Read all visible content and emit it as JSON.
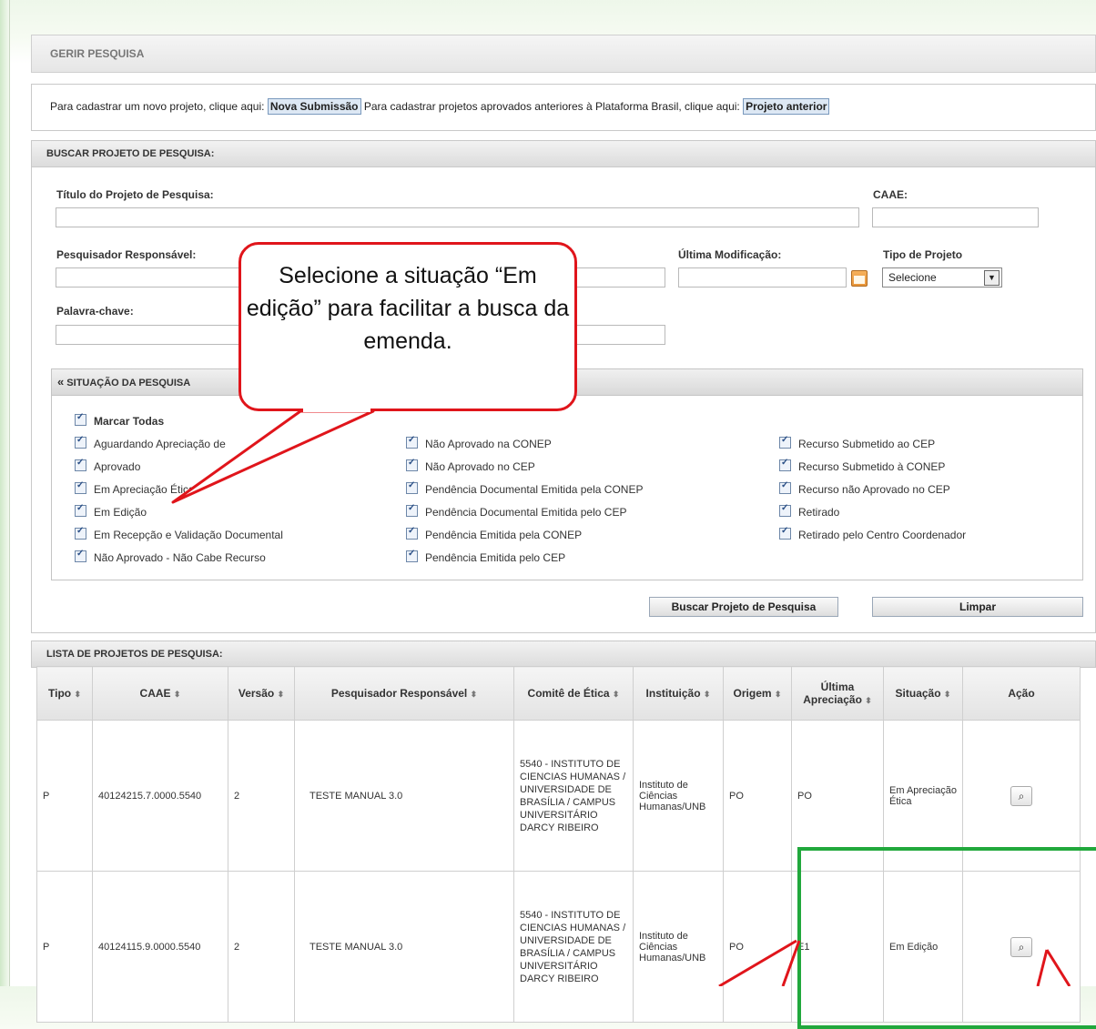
{
  "header": {
    "title": "GERIR PESQUISA"
  },
  "intro": {
    "text1": "Para cadastrar um novo projeto, clique aqui:",
    "btn_nova": "Nova Submissão",
    "text2": "Para cadastrar projetos aprovados anteriores à Plataforma Brasil, clique aqui:",
    "btn_anterior": "Projeto anterior"
  },
  "search": {
    "header": "BUSCAR PROJETO DE PESQUISA:",
    "label_titulo": "Título do Projeto de Pesquisa:",
    "label_caae": "CAAE:",
    "label_pesquisador": "Pesquisador Responsável:",
    "label_ultima": "Última Modificação:",
    "label_tipo": "Tipo de Projeto",
    "tipo_value": "Selecione",
    "label_palavra": "Palavra-chave:"
  },
  "situacao": {
    "header": "SITUAÇÃO DA PESQUISA",
    "collapse_icon": "«",
    "marcar_todas": "Marcar Todas",
    "col1": [
      "Aguardando Apreciação de",
      "Aprovado",
      "Em Apreciação Ética",
      "Em Edição",
      "Em Recepção e Validação Documental",
      "Não Aprovado - Não Cabe Recurso"
    ],
    "col2": [
      "Não Aprovado na CONEP",
      "Não Aprovado no CEP",
      "Pendência Documental Emitida pela CONEP",
      "Pendência Documental Emitida pelo CEP",
      "Pendência Emitida pela CONEP",
      "Pendência Emitida pelo CEP"
    ],
    "col3": [
      "Recurso Submetido ao CEP",
      "Recurso Submetido à CONEP",
      "Recurso não Aprovado no CEP",
      "Retirado",
      "Retirado pelo Centro Coordenador"
    ]
  },
  "actions": {
    "buscar": "Buscar Projeto de Pesquisa",
    "limpar": "Limpar"
  },
  "list": {
    "header": "LISTA DE PROJETOS DE PESQUISA:",
    "columns": [
      "Tipo",
      "CAAE",
      "Versão",
      "Pesquisador Responsável",
      "Comitê de Ética",
      "Instituição",
      "Origem",
      "Última Apreciação",
      "Situação",
      "Ação"
    ],
    "rows": [
      {
        "tipo": "P",
        "caae": "40124215.7.0000.5540",
        "versao": "2",
        "pesquisador": "TESTE MANUAL 3.0",
        "comite": "5540 - INSTITUTO DE CIENCIAS HUMANAS / UNIVERSIDADE DE BRASÍLIA / CAMPUS UNIVERSITÁRIO DARCY RIBEIRO",
        "instituicao": "Instituto de Ciências Humanas/UNB",
        "origem": "PO",
        "ultima": "PO",
        "situacao": "Em Apreciação Ética"
      },
      {
        "tipo": "P",
        "caae": "40124115.9.0000.5540",
        "versao": "2",
        "pesquisador": "TESTE MANUAL 3.0",
        "comite": "5540 - INSTITUTO DE CIENCIAS HUMANAS / UNIVERSIDADE DE BRASÍLIA / CAMPUS UNIVERSITÁRIO DARCY RIBEIRO",
        "instituicao": "Instituto de Ciências Humanas/UNB",
        "origem": "PO",
        "ultima": "E1",
        "situacao": "Em Edição"
      }
    ]
  },
  "callout": {
    "text": "Selecione a situação “Em edição” para facilitar a busca da emenda."
  },
  "colors": {
    "callout_border": "#e0151b",
    "highlight_box": "#21a83c",
    "arrow": "#e0151b"
  }
}
